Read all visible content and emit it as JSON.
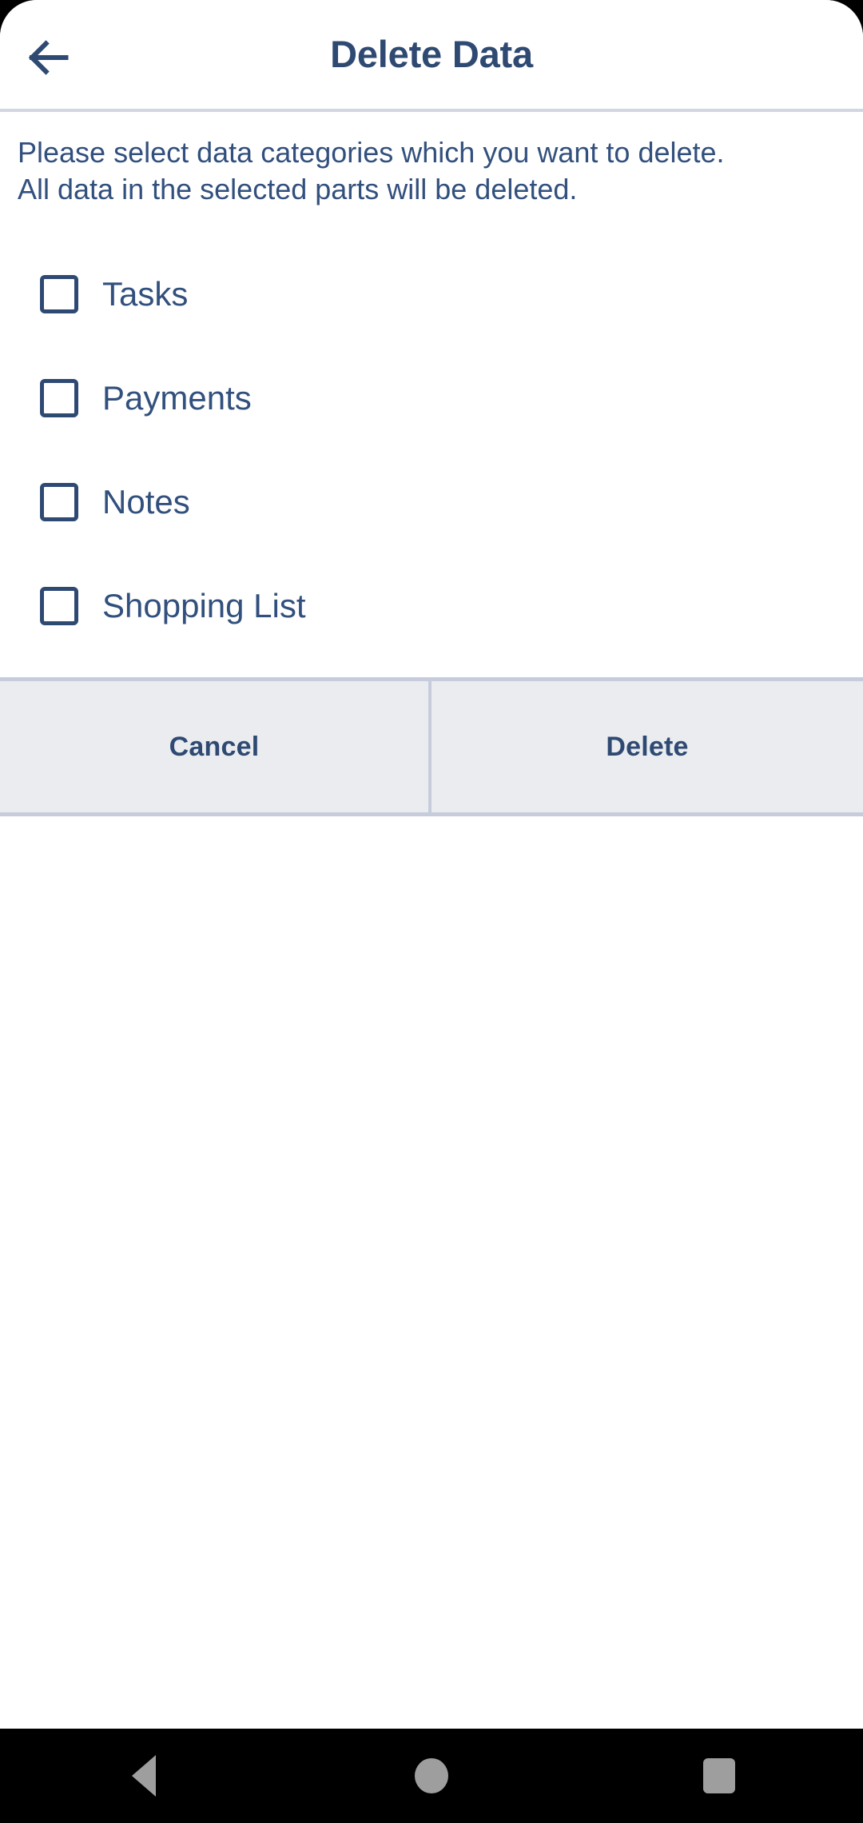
{
  "theme": {
    "accent": "#2f4a72",
    "text": "#32507d",
    "divider": "#d2d6e3",
    "action_bar_bg": "#eaecf0",
    "action_bar_border": "#c7ccdc",
    "surface": "#ffffff",
    "nav_bar_bg": "#000000",
    "nav_glyph": "#9e9e9e"
  },
  "app_bar": {
    "back_icon": "arrow-left-icon",
    "title": "Delete Data"
  },
  "content": {
    "description_line_1": "Please select data categories which you want to delete.",
    "description_line_2": "All data in the selected parts will be deleted.",
    "categories": [
      {
        "label": "Tasks",
        "checked": false
      },
      {
        "label": "Payments",
        "checked": false
      },
      {
        "label": "Notes",
        "checked": false
      },
      {
        "label": "Shopping List",
        "checked": false
      }
    ]
  },
  "actions": {
    "cancel_label": "Cancel",
    "delete_label": "Delete"
  },
  "navigation_bar": {
    "back_icon": "triangle-back-icon",
    "home_icon": "circle-home-icon",
    "recents_icon": "square-recents-icon"
  }
}
